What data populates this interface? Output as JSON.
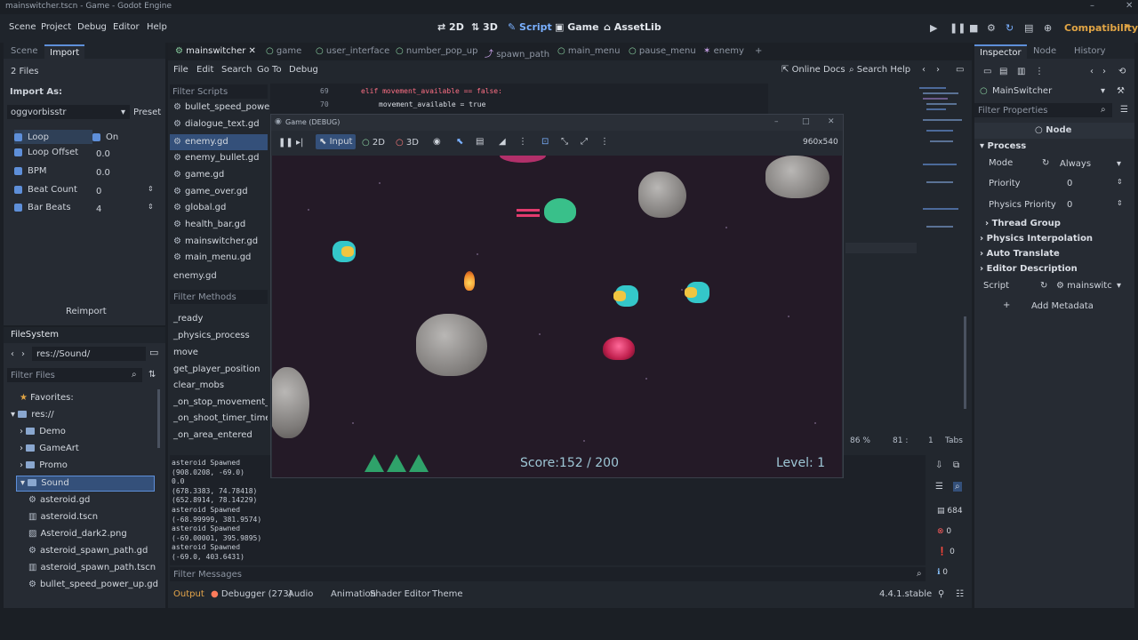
{
  "window": {
    "title": "mainswitcher.tscn - Game - Godot Engine"
  },
  "menubar": {
    "menus": [
      "Scene",
      "Project",
      "Debug",
      "Editor",
      "Help"
    ],
    "workspaces": [
      "2D",
      "3D",
      "Script",
      "Game",
      "AssetLib"
    ],
    "renderer": "Compatibility"
  },
  "leftdock": {
    "tabs": [
      "Scene",
      "Import"
    ],
    "files_count": "2 Files",
    "import_as_label": "Import As:",
    "import_as_value": "oggvorbisstr",
    "preset_label": "Preset",
    "props": [
      {
        "name": "Loop",
        "value": "On"
      },
      {
        "name": "Loop Offset",
        "value": "0.0"
      },
      {
        "name": "BPM",
        "value": "0.0"
      },
      {
        "name": "Beat Count",
        "value": "0"
      },
      {
        "name": "Bar Beats",
        "value": "4"
      }
    ],
    "reimport_label": "Reimport"
  },
  "filesystem": {
    "title": "FileSystem",
    "path": "res://Sound/",
    "filter_placeholder": "Filter Files",
    "favorites": "Favorites:",
    "root": "res://",
    "folders": [
      "Demo",
      "GameArt",
      "Promo",
      "Sound"
    ],
    "files": [
      "asteroid.gd",
      "asteroid.tscn",
      "Asteroid_dark2.png",
      "asteroid_spawn_path.gd",
      "asteroid_spawn_path.tscn",
      "bullet_speed_power_up.gd"
    ]
  },
  "editor": {
    "menus": [
      "File",
      "Edit",
      "Search",
      "Go To",
      "Debug"
    ],
    "online_docs": "Online Docs",
    "search_help": "Search Help",
    "tabs": [
      "mainswitcher",
      "game",
      "user_interface",
      "number_pop_up",
      "spawn_path",
      "main_menu",
      "pause_menu",
      "enemy"
    ],
    "filter_scripts": "Filter Scripts",
    "scripts": [
      "bullet_speed_power_u...",
      "dialogue_text.gd",
      "enemy.gd",
      "enemy_bullet.gd",
      "game.gd",
      "game_over.gd",
      "global.gd",
      "health_bar.gd",
      "mainswitcher.gd",
      "main_menu.gd"
    ],
    "current_script": "enemy.gd",
    "filter_methods": "Filter Methods",
    "methods": [
      "_ready",
      "_physics_process",
      "move",
      "get_player_position",
      "clear_mobs",
      "_on_stop_movement_tim",
      "_on_shoot_timer_timeou",
      "_on_area_entered"
    ],
    "code_lines": [
      {
        "num": "69",
        "text": "elif movement_available == false:"
      },
      {
        "num": "70",
        "text": "movement_available = true"
      }
    ],
    "status": {
      "zoom": "86 %",
      "line": "81 :",
      "col": "1",
      "indent": "Tabs"
    },
    "console_lines": [
      "asteroid Spawned",
      "(908.0208, -69.0)",
      "0.0",
      "(678.3383, 74.78418)",
      "(652.8914, 78.14229)",
      "asteroid Spawned",
      "(-68.99999, 381.9574)",
      "asteroid Spawned",
      "(-69.00001, 395.9895)",
      "asteroid Spawned",
      "(-69.0, 403.6431)"
    ],
    "filter_messages": "Filter Messages",
    "bottom_tabs": [
      "Output",
      "Debugger (273)",
      "Audio",
      "Animation",
      "Shader Editor",
      "Theme"
    ],
    "version": "4.4.1.stable",
    "counters": [
      "684",
      "0",
      "0",
      "0"
    ]
  },
  "inspector": {
    "tabs": [
      "Inspector",
      "Node",
      "History"
    ],
    "object": "MainSwitcher",
    "filter_placeholder": "Filter Properties",
    "node_label": "Node",
    "process_label": "Process",
    "mode_label": "Mode",
    "mode_value": "Always",
    "priority_label": "Priority",
    "priority_value": "0",
    "physics_priority_label": "Physics Priority",
    "physics_priority_value": "0",
    "sections": [
      "Thread Group",
      "Physics Interpolation",
      "Auto Translate",
      "Editor Description"
    ],
    "script_label": "Script",
    "script_value": "mainswitc",
    "add_metadata": "Add Metadata"
  },
  "game_window": {
    "title": "Game (DEBUG)",
    "toolbar": {
      "input": "Input",
      "2d": "2D",
      "3d": "3D",
      "resolution": "960x540"
    },
    "hud": {
      "score": "Score:152 / 200",
      "level": "Level: 1"
    },
    "lives": 3
  }
}
